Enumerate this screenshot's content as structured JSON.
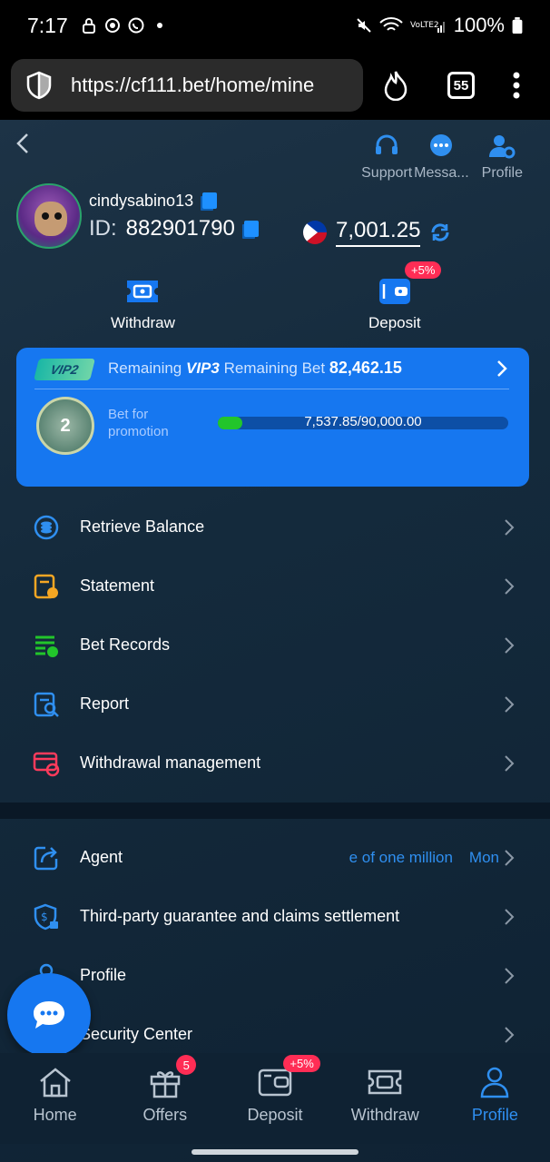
{
  "status_bar": {
    "time": "7:17",
    "battery": "100%"
  },
  "browser": {
    "url": "https://cf111.bet/home/mine",
    "tabs_count": "55"
  },
  "header": {
    "actions": [
      {
        "label": "Support"
      },
      {
        "label": "Messa..."
      },
      {
        "label": "Profile"
      }
    ]
  },
  "user": {
    "username": "cindysabino13",
    "id_label": "ID:",
    "id_value": "882901790",
    "balance": "7,001.25"
  },
  "quick_actions": {
    "withdraw": "Withdraw",
    "deposit": "Deposit",
    "deposit_badge": "+5%"
  },
  "vip": {
    "current_level_tag": "VIP2",
    "remaining_prefix": "Remaining",
    "next_level": "VIP3",
    "remaining_bet_label": "Remaining Bet",
    "remaining_bet_value": "82,462.15",
    "medal_number": "2",
    "promo_label": "Bet for promotion",
    "progress_text": "7,537.85/90,000.00",
    "progress_fraction": 0.084
  },
  "menu_group_1": [
    {
      "label": "Retrieve Balance",
      "icon": "coin-stack-icon"
    },
    {
      "label": "Statement",
      "icon": "statement-icon"
    },
    {
      "label": "Bet Records",
      "icon": "bet-records-icon"
    },
    {
      "label": "Report",
      "icon": "report-icon"
    },
    {
      "label": "Withdrawal management",
      "icon": "withdrawal-management-icon"
    }
  ],
  "menu_group_2": [
    {
      "label": "Agent",
      "icon": "share-icon",
      "marquee": "e of one million",
      "extra": "Mon"
    },
    {
      "label": "Third-party guarantee and claims settlement",
      "icon": "shield-dollar-icon"
    },
    {
      "label": "Profile",
      "icon": "user-icon"
    },
    {
      "label": "Security Center",
      "icon": "security-icon"
    }
  ],
  "tabbar": [
    {
      "label": "Home"
    },
    {
      "label": "Offers",
      "badge": "5"
    },
    {
      "label": "Deposit",
      "badge": "+5%"
    },
    {
      "label": "Withdraw"
    },
    {
      "label": "Profile"
    }
  ],
  "colors": {
    "accent": "#1677f0",
    "link": "#2f8ff0",
    "badge": "#ff2d55",
    "progress": "#22c52b",
    "background": "#0c1d2e"
  }
}
